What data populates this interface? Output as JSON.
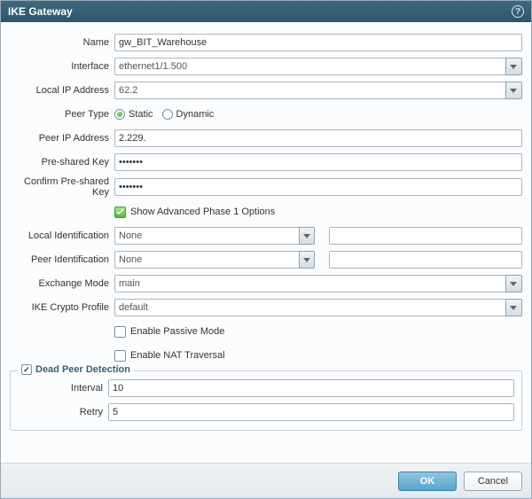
{
  "title": "IKE Gateway",
  "labels": {
    "name": "Name",
    "interface": "Interface",
    "local_ip": "Local IP Address",
    "peer_type": "Peer Type",
    "peer_ip": "Peer IP Address",
    "psk": "Pre-shared Key",
    "psk_confirm": "Confirm Pre-shared Key",
    "show_advanced": "Show Advanced Phase 1 Options",
    "local_id": "Local Identification",
    "peer_id": "Peer Identification",
    "exchange_mode": "Exchange Mode",
    "ike_profile": "IKE Crypto Profile",
    "enable_passive": "Enable Passive Mode",
    "enable_nat": "Enable NAT Traversal",
    "dpd": "Dead Peer Detection",
    "interval": "Interval",
    "retry": "Retry"
  },
  "values": {
    "name": "gw_BIT_Warehouse",
    "interface": "ethernet1/1.500",
    "local_ip": "62.2",
    "peer_type": "static",
    "peer_type_static": "Static",
    "peer_type_dynamic": "Dynamic",
    "peer_ip": "2.229.",
    "psk": "•••••••",
    "psk_confirm": "•••••••",
    "show_advanced": true,
    "local_id": "None",
    "peer_id": "None",
    "exchange_mode": "main",
    "ike_profile": "default",
    "enable_passive": false,
    "enable_nat": false,
    "dpd_enabled": true,
    "interval": "10",
    "retry": "5"
  },
  "buttons": {
    "ok": "OK",
    "cancel": "Cancel"
  }
}
